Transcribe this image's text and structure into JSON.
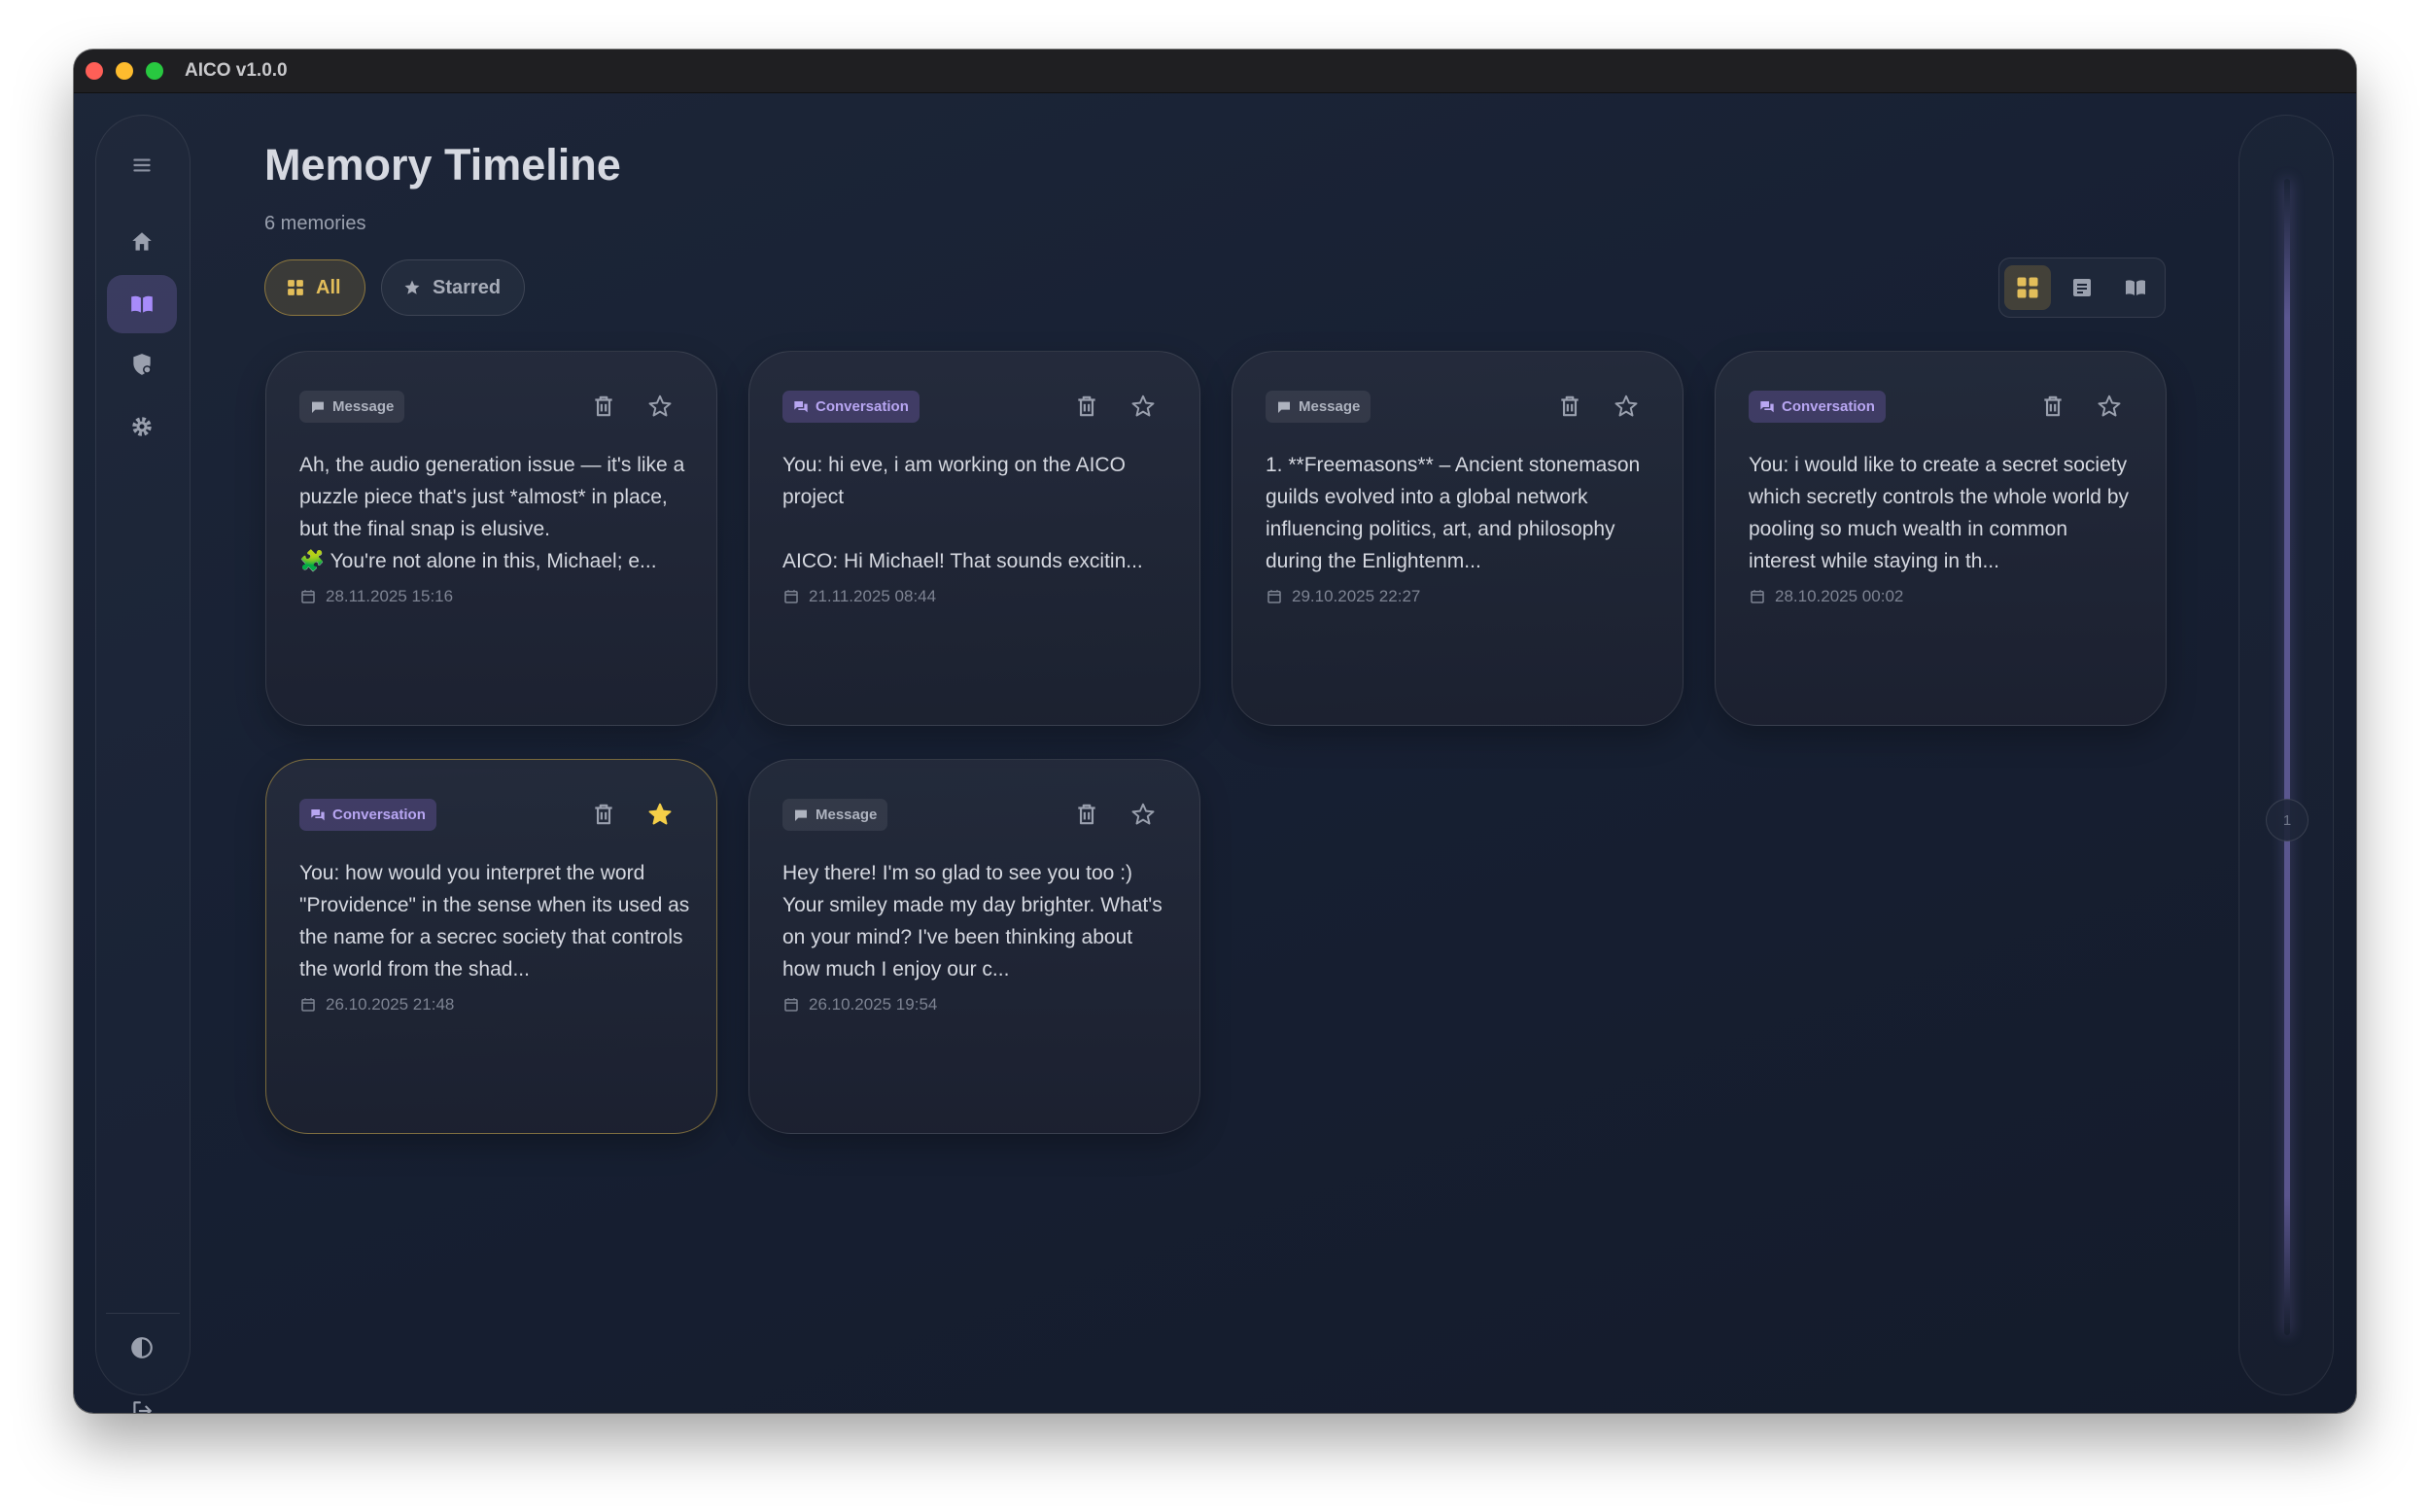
{
  "app": {
    "title": "AICO v1.0.0"
  },
  "header": {
    "title": "Memory Timeline",
    "subtitle": "6 memories"
  },
  "filters": [
    {
      "label": "All",
      "active": true,
      "icon": "grid-icon"
    },
    {
      "label": "Starred",
      "active": false,
      "icon": "star-icon"
    }
  ],
  "view_modes": [
    {
      "icon": "grid-view-icon",
      "active": true
    },
    {
      "icon": "list-view-icon",
      "active": false
    },
    {
      "icon": "book-view-icon",
      "active": false
    }
  ],
  "scrubber": {
    "page": "1"
  },
  "cards": [
    {
      "type": "Message",
      "kind": "msg",
      "starred": false,
      "text": "Ah, the audio generation issue — it's like a puzzle piece that's just *almost* in place, but the final snap is elusive.\n🧩 You're not alone in this, Michael; e...",
      "date": "28.11.2025 15:16"
    },
    {
      "type": "Conversation",
      "kind": "conv",
      "starred": false,
      "text": "You: hi eve, i am working on the AICO project\n\nAICO: Hi Michael! That sounds excitin...",
      "date": "21.11.2025 08:44"
    },
    {
      "type": "Message",
      "kind": "msg",
      "starred": false,
      "text": "1. **Freemasons** – Ancient stonemason guilds evolved into a global network influencing politics, art, and philosophy during the Enlightenm...",
      "date": "29.10.2025 22:27"
    },
    {
      "type": "Conversation",
      "kind": "conv",
      "starred": false,
      "text": "You: i would like to create a secret society which secretly controls the whole world by pooling so much wealth in common interest while staying in th...",
      "date": "28.10.2025 00:02"
    },
    {
      "type": "Conversation",
      "kind": "conv",
      "starred": true,
      "text": "You: how would you interpret the word \"Providence\" in the sense when its used as the name for a secrec society that controls the world from the shad...",
      "date": "26.10.2025 21:48"
    },
    {
      "type": "Message",
      "kind": "msg",
      "starred": false,
      "text": "Hey there! I'm so glad to see you too :) Your smiley made my day brighter. What's on your mind? I've been thinking about how much I enjoy our c...",
      "date": "26.10.2025 19:54"
    }
  ],
  "colors": {
    "accent_gold": "#e3be5a",
    "accent_purple": "#b8a6f2",
    "background": "#172033"
  }
}
